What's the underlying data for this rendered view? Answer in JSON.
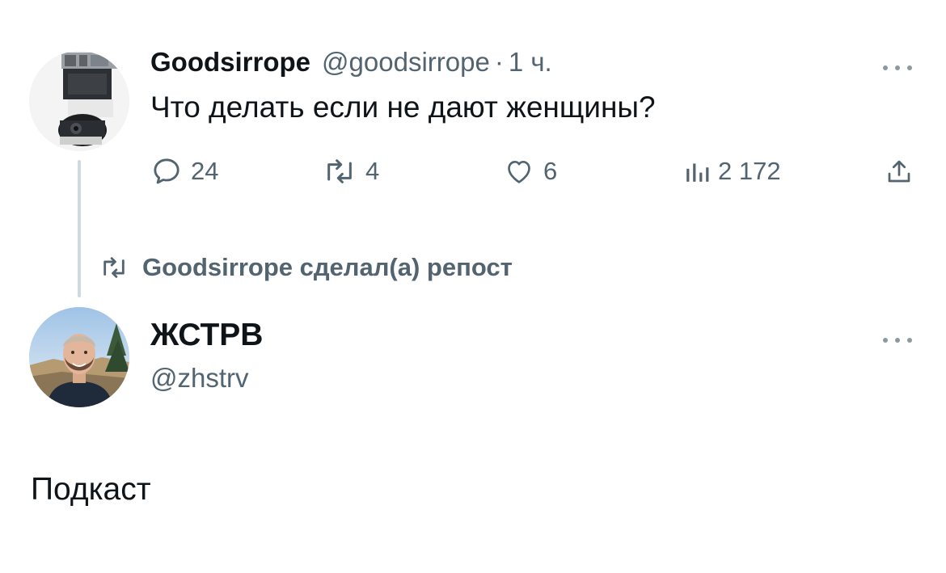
{
  "tweet": {
    "author_name": "Goodsirrope",
    "author_handle": "@goodsirrope",
    "separator": "·",
    "time": "1 ч.",
    "text": "Что делать если не дают женщины?",
    "avatar_icon": "security-camera-avatar",
    "more_icon": "more-dots-icon",
    "actions": {
      "replies": "24",
      "reposts": "4",
      "likes": "6",
      "views": "2 172"
    }
  },
  "repost_notice": {
    "icon": "repost-icon",
    "text": "Goodsirrope сделал(а) репост"
  },
  "reposted_tweet": {
    "author_name": "ЖСТРВ",
    "author_handle": "@zhstrv",
    "text": "Подкаст",
    "avatar_icon": "person-photo-avatar",
    "more_icon": "more-dots-icon"
  },
  "colors": {
    "text_primary": "#0f1419",
    "text_secondary": "#536471",
    "thread_line": "#cfd9de",
    "background": "#ffffff"
  }
}
